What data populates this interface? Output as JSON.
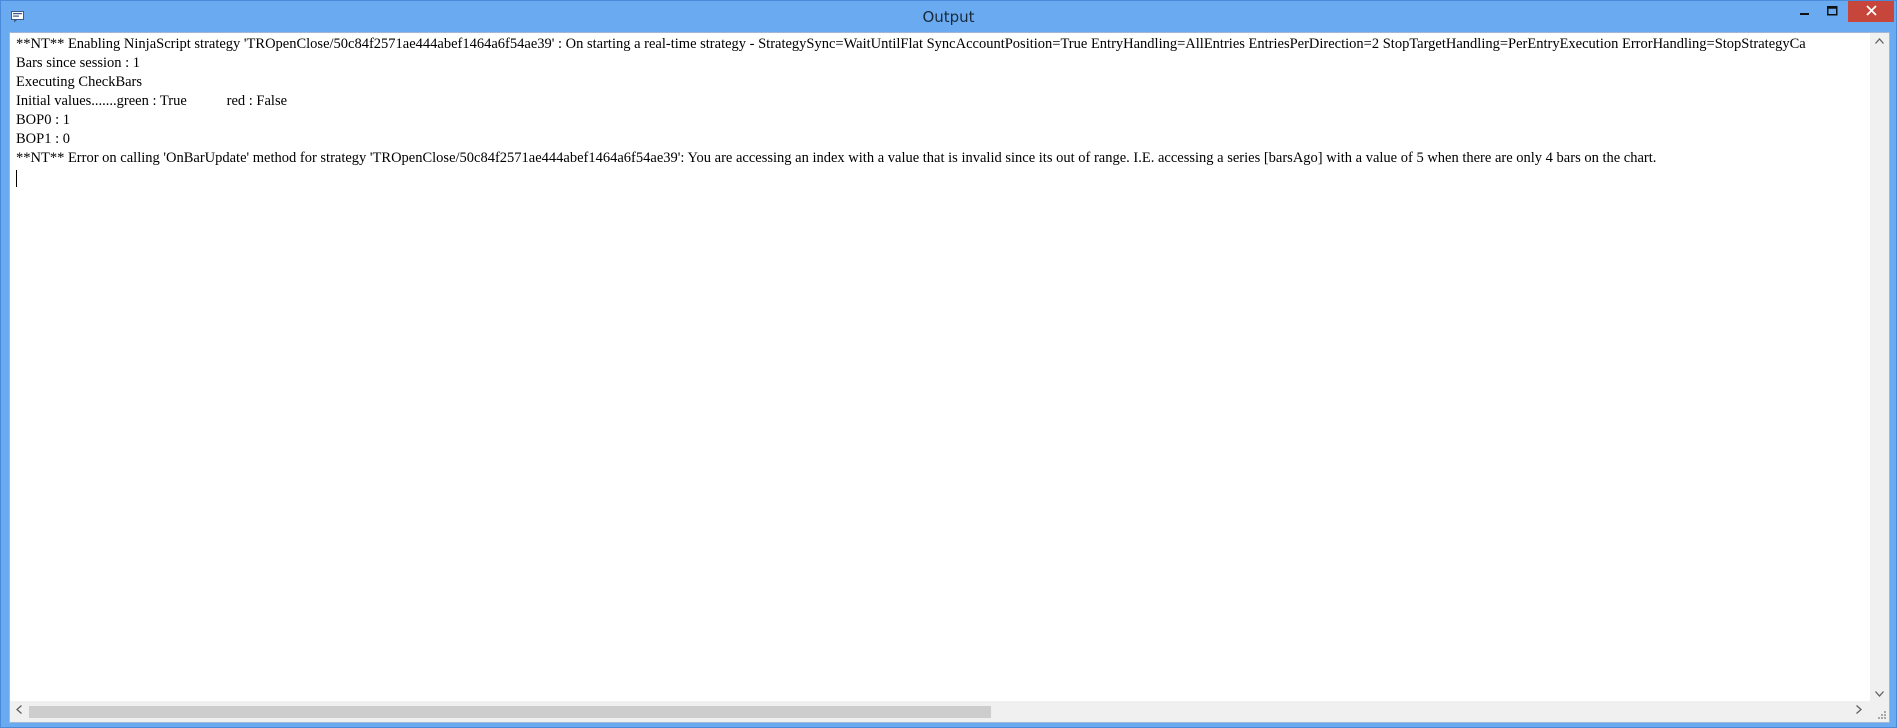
{
  "window": {
    "title": "Output"
  },
  "icons": {
    "app": "output-window-icon",
    "minimize": "minimize-icon",
    "maximize": "maximize-icon",
    "close": "close-icon",
    "scroll_up": "chevron-up-icon",
    "scroll_down": "chevron-down-icon",
    "scroll_left": "chevron-left-icon",
    "scroll_right": "chevron-right-icon"
  },
  "colors": {
    "titlebar": "#6aaaf0",
    "close_button": "#c7463b"
  },
  "output": {
    "lines": [
      "**NT** Enabling NinjaScript strategy 'TROpenClose/50c84f2571ae444abef1464a6f54ae39' : On starting a real-time strategy - StrategySync=WaitUntilFlat SyncAccountPosition=True EntryHandling=AllEntries EntriesPerDirection=2 StopTargetHandling=PerEntryExecution ErrorHandling=StopStrategyCa",
      "Bars since session : 1",
      "Executing CheckBars",
      "Initial values.......green : True           red : False",
      "BOP0 : 1",
      "BOP1 : 0",
      "**NT** Error on calling 'OnBarUpdate' method for strategy 'TROpenClose/50c84f2571ae444abef1464a6f54ae39': You are accessing an index with a value that is invalid since its out of range. I.E. accessing a series [barsAgo] with a value of 5 when there are only 4 bars on the chart."
    ]
  }
}
